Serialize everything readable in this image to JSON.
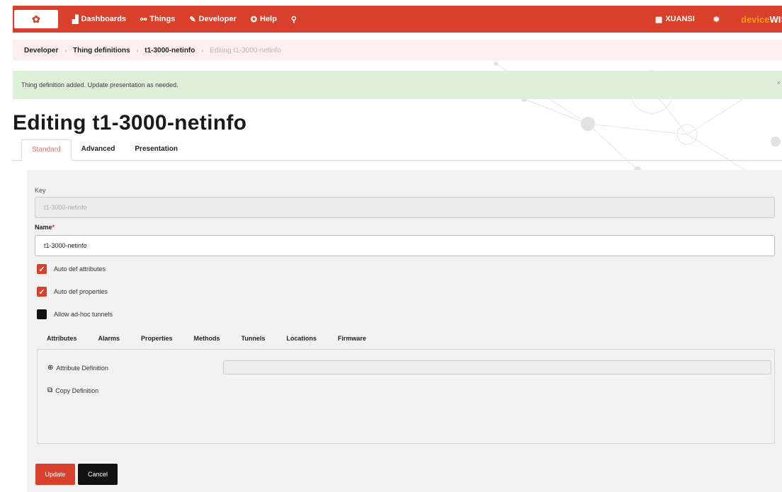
{
  "nav": {
    "logo_icon": "china-unicom-logo",
    "items": [
      {
        "label": "Dashboards",
        "icon": "bar-chart-icon",
        "glyph": "▟"
      },
      {
        "label": "Things",
        "icon": "things-icon",
        "glyph": "⚯"
      },
      {
        "label": "Developer",
        "icon": "wrench-icon",
        "glyph": "✎"
      },
      {
        "label": "Help",
        "icon": "help-icon",
        "glyph": "✪"
      }
    ],
    "search_glyph": "⚲",
    "org": {
      "label": "XUANSI",
      "icon": "building-icon",
      "glyph": "▦"
    },
    "settings_glyph": "✹",
    "brand_part1": "device",
    "brand_part2": "WISE",
    "accent_color": "#d9402b"
  },
  "breadcrumb": {
    "items": [
      "Developer",
      "Thing definitions",
      "t1-3000-netinfo"
    ],
    "current": "Editing t1-3000-netinfo",
    "separator": "›"
  },
  "alert": {
    "message": "Thing definition added. Update presentation as needed.",
    "close": "×"
  },
  "page": {
    "title": "Editing t1-3000-netinfo"
  },
  "tabs": [
    "Standard",
    "Advanced",
    "Presentation"
  ],
  "form": {
    "key_label": "Key",
    "key_value": "t1-3000-netinfo",
    "name_label": "Name",
    "name_required": "*",
    "name_value": "t1-3000-netinfo",
    "checkboxes": [
      {
        "label": "Auto def attributes",
        "checked": true
      },
      {
        "label": "Auto def properties",
        "checked": true
      },
      {
        "label": "Allow ad-hoc tunnels",
        "checked": false
      }
    ],
    "check_glyph": "✓"
  },
  "subtabs": [
    "Attributes",
    "Alarms",
    "Properties",
    "Methods",
    "Tunnels",
    "Locations",
    "Firmware"
  ],
  "attributes": {
    "add_label": "Attribute Definition",
    "add_glyph": "⊕",
    "copy_label": "Copy Definition",
    "copy_glyph": "⧉"
  },
  "buttons": {
    "update": "Update",
    "cancel": "Cancel"
  }
}
